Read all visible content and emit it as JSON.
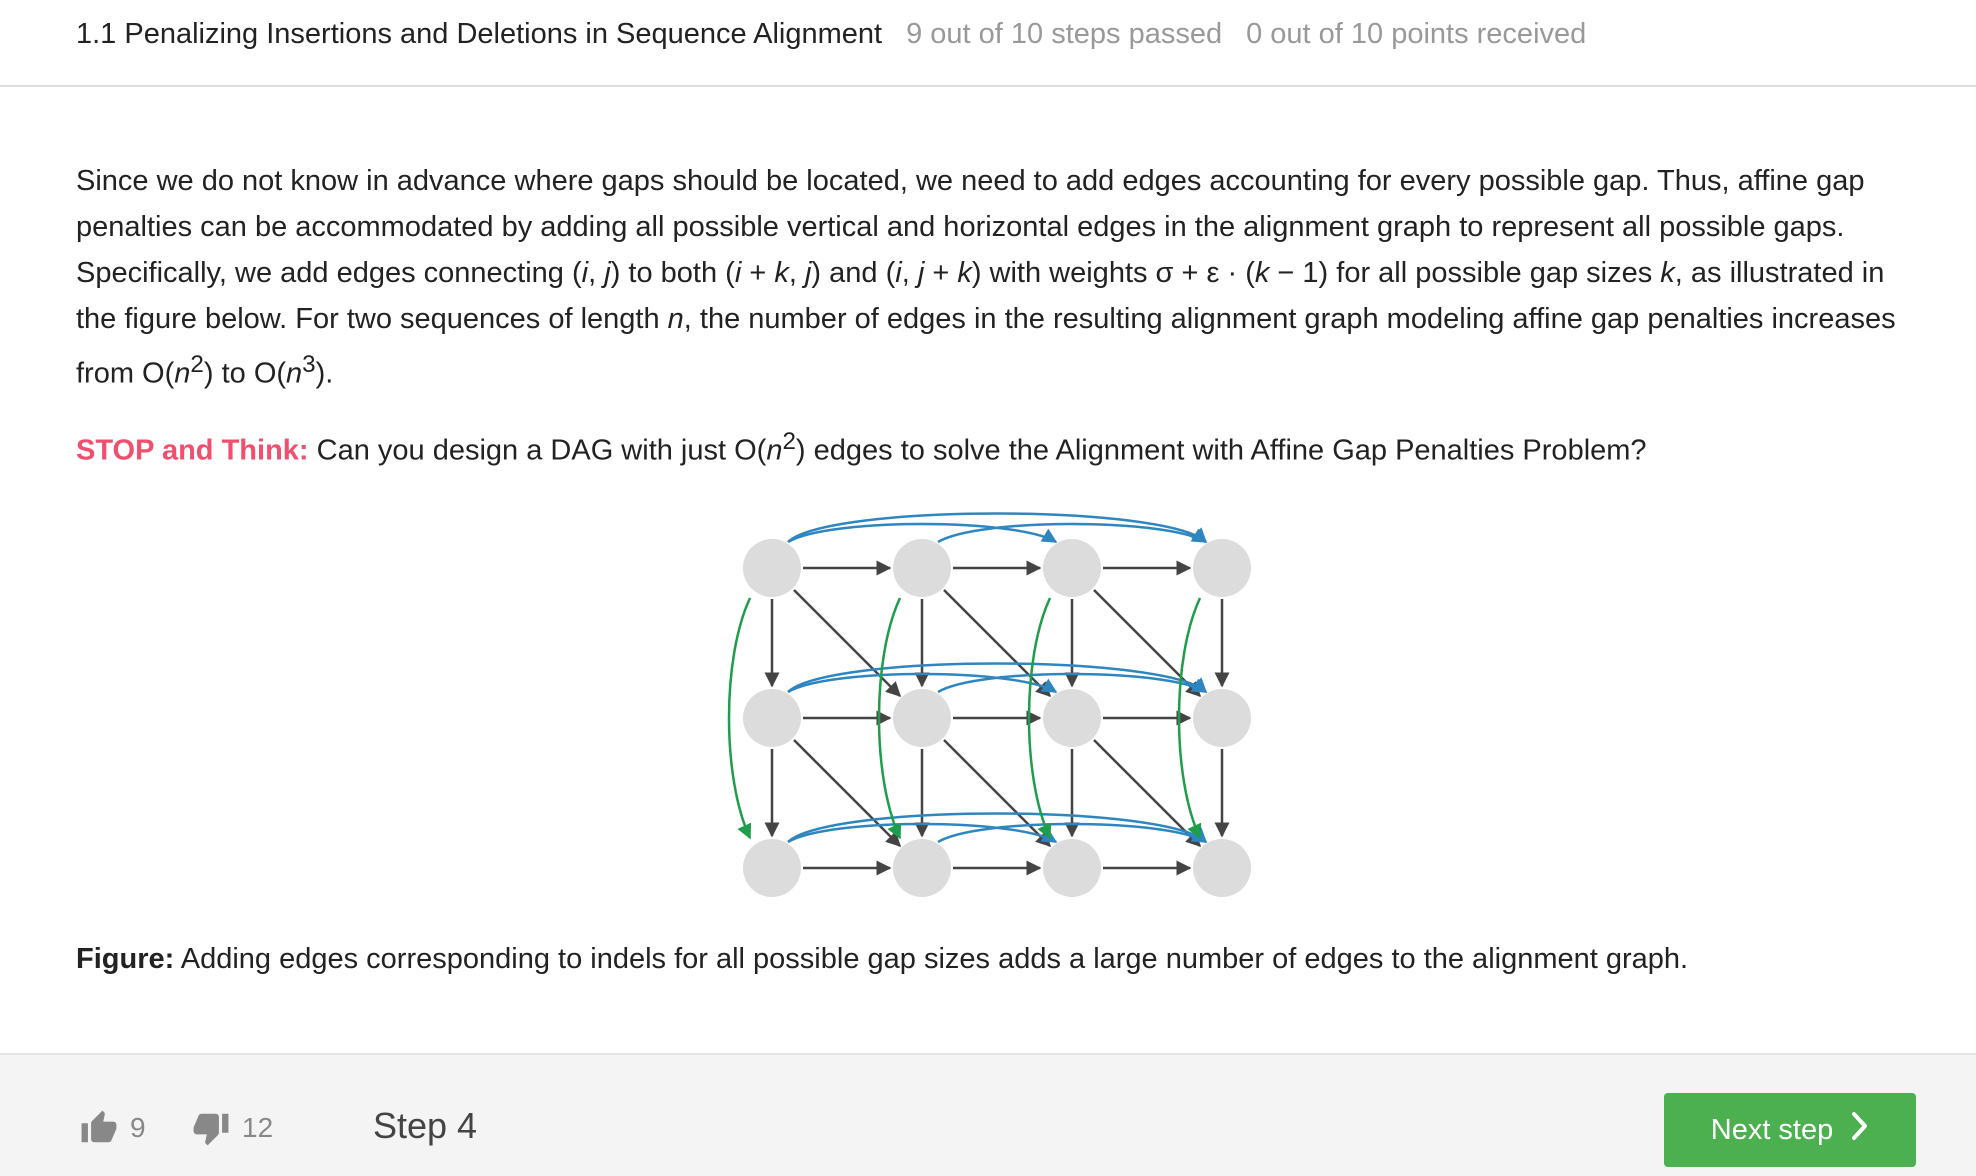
{
  "header": {
    "title": "1.1 Penalizing Insertions and Deletions in Sequence Alignment",
    "steps_passed": "9 out of 10 steps passed",
    "points": "0 out of 10 points  received"
  },
  "content": {
    "p1_a": "Since we do not know in advance where gaps should be located, we need to add edges accounting for every possible gap. Thus, affine gap penalties can be accommodated by adding all possible vertical and horizontal edges in the alignment graph to represent all possible gaps. Specifically, we add edges connecting (",
    "p1_i1": "i",
    "p1_b": ", ",
    "p1_j1": "j",
    "p1_c": ") to both (",
    "p1_i2": "i",
    "p1_d": " + ",
    "p1_k1": "k",
    "p1_e": ", ",
    "p1_j2": "j",
    "p1_f": ") and (",
    "p1_i3": "i",
    "p1_g": ", ",
    "p1_j3": "j",
    "p1_h": " + ",
    "p1_k2": "k",
    "p1_m": ") with weights σ + ε · (",
    "p1_k3": "k",
    "p1_n": " − 1) for all possible gap sizes ",
    "p1_k4": "k",
    "p1_o": ", as illustrated in the figure below. For two sequences of length ",
    "p1_n1": "n",
    "p1_p": ", the number of edges in the resulting alignment graph modeling affine gap penalties increases from O(",
    "p1_n2": "n",
    "p1_sup2": "2",
    "p1_q": ") to O(",
    "p1_n3": "n",
    "p1_sup3": "3",
    "p1_r": ").",
    "stop_label": "STOP and Think:",
    "stop_a": " Can you design a DAG with just O(",
    "stop_n": "n",
    "stop_sup": "2",
    "stop_b": ") edges to solve the Alignment with Affine Gap Penalties Problem?"
  },
  "figure": {
    "rows": 3,
    "cols": 4,
    "colors": {
      "node": "#dcdcdc",
      "edge": "#444444",
      "horizontal_gap": "#2e86c1",
      "vertical_gap": "#1e9e4a"
    }
  },
  "caption": {
    "label": "Figure:",
    "text": " Adding edges corresponding to indels for all possible gap sizes adds a large number of edges to the alignment graph."
  },
  "footer": {
    "likes": "9",
    "dislikes": "12",
    "step": "Step 4",
    "next_label": "Next step",
    "icons": {
      "like": "thumbs-up-icon",
      "dislike": "thumbs-down-icon",
      "next": "chevron-right-icon"
    }
  }
}
